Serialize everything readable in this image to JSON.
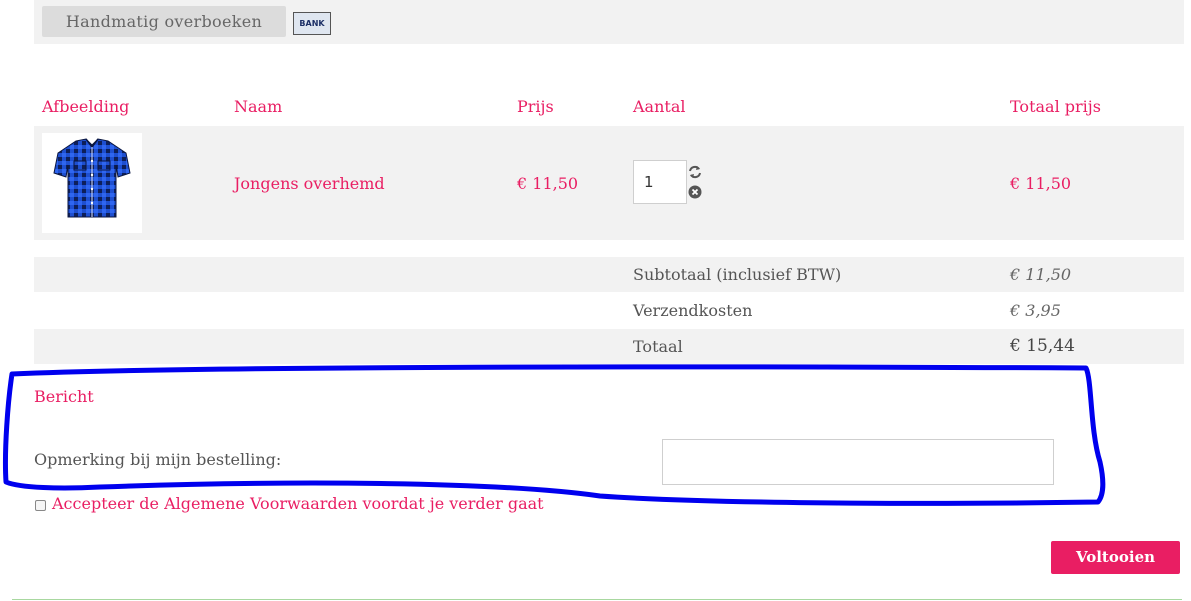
{
  "payment": {
    "method_label": "Handmatig overboeken",
    "bank_logo_text": "BANK"
  },
  "table": {
    "headers": [
      "Afbeelding",
      "Naam",
      "Prijs",
      "Aantal",
      "Totaal prijs"
    ],
    "rows": [
      {
        "image_icon": "blue-checkered-shirt",
        "name": "Jongens overhemd",
        "price": "€ 11,50",
        "quantity": "1",
        "total": "€ 11,50"
      }
    ]
  },
  "summary": {
    "subtotal_label": "Subtotaal (inclusief BTW)",
    "subtotal_value": "€ 11,50",
    "shipping_label": "Verzendkosten",
    "shipping_value": "€ 3,95",
    "total_label": "Totaal",
    "total_value": "€ 15,44"
  },
  "message": {
    "title": "Bericht",
    "note_label": "Opmerking bij mijn bestelling:",
    "note_value": ""
  },
  "terms": {
    "label": "Accepteer de Algemene Voorwaarden voordat je verder gaat",
    "checked": false
  },
  "actions": {
    "finish_label": "Voltooien"
  },
  "colors": {
    "accent": "#e91e63",
    "row_background": "#f2f2f2",
    "annotation": "#0000ee"
  }
}
